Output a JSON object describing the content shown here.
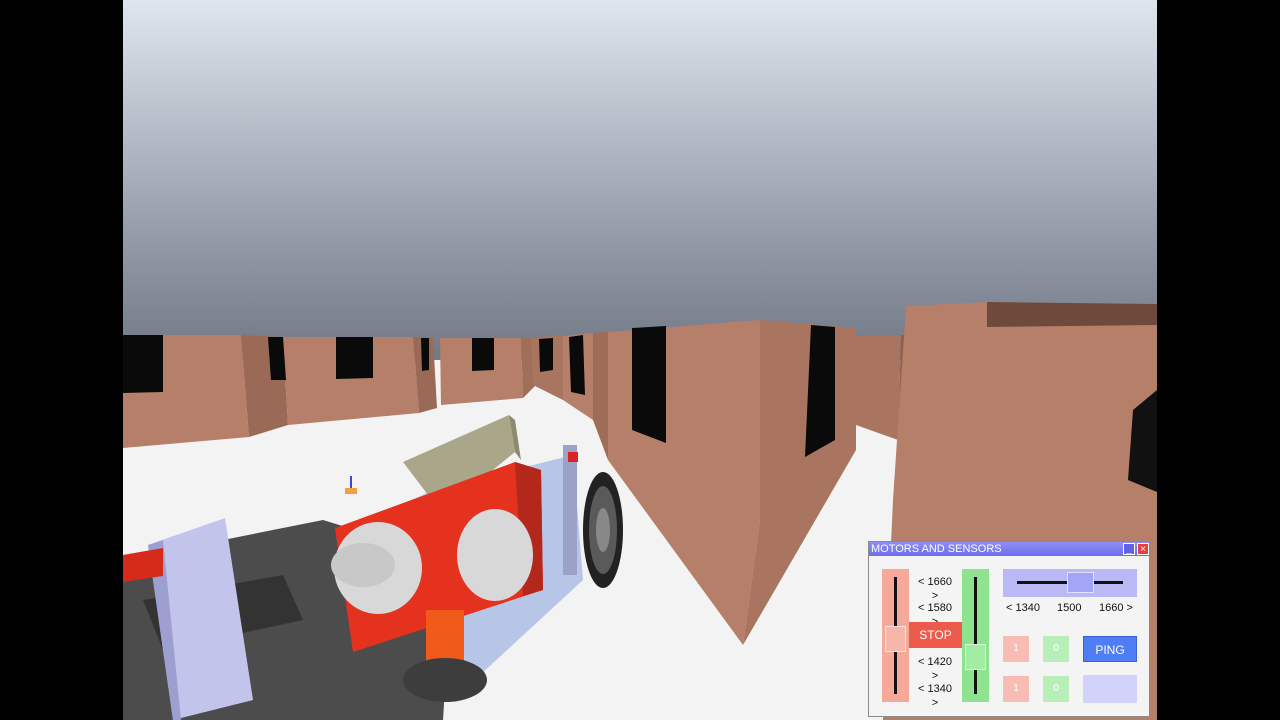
{
  "panel": {
    "title": "MOTORS AND SENSORS",
    "minimize_label": "_",
    "close_label": "×",
    "left_motor": {
      "speed_labels": [
        "< 1660 >",
        "< 1580 >",
        "< 1420 >",
        "< 1340 >"
      ],
      "level": 0.47,
      "color": "#f6a89a"
    },
    "right_motor": {
      "level": 0.3,
      "color": "#8ee38e"
    },
    "stop_label": "STOP",
    "servo": {
      "min_label": "< 1340",
      "mid_label": "1500",
      "max_label": "1660 >",
      "value": 1500,
      "color": "#b9b9f5"
    },
    "sensors": {
      "red_top": "1",
      "green_top": "0",
      "red_bottom": "1",
      "green_bottom": "0"
    },
    "ping_label": "PING"
  },
  "colors": {
    "sky_top": "#dfe4ec",
    "sky_bottom": "#6c7380",
    "wall": "#b8806a",
    "floor": "#f2f2f2",
    "robot_red": "#e3301e"
  }
}
